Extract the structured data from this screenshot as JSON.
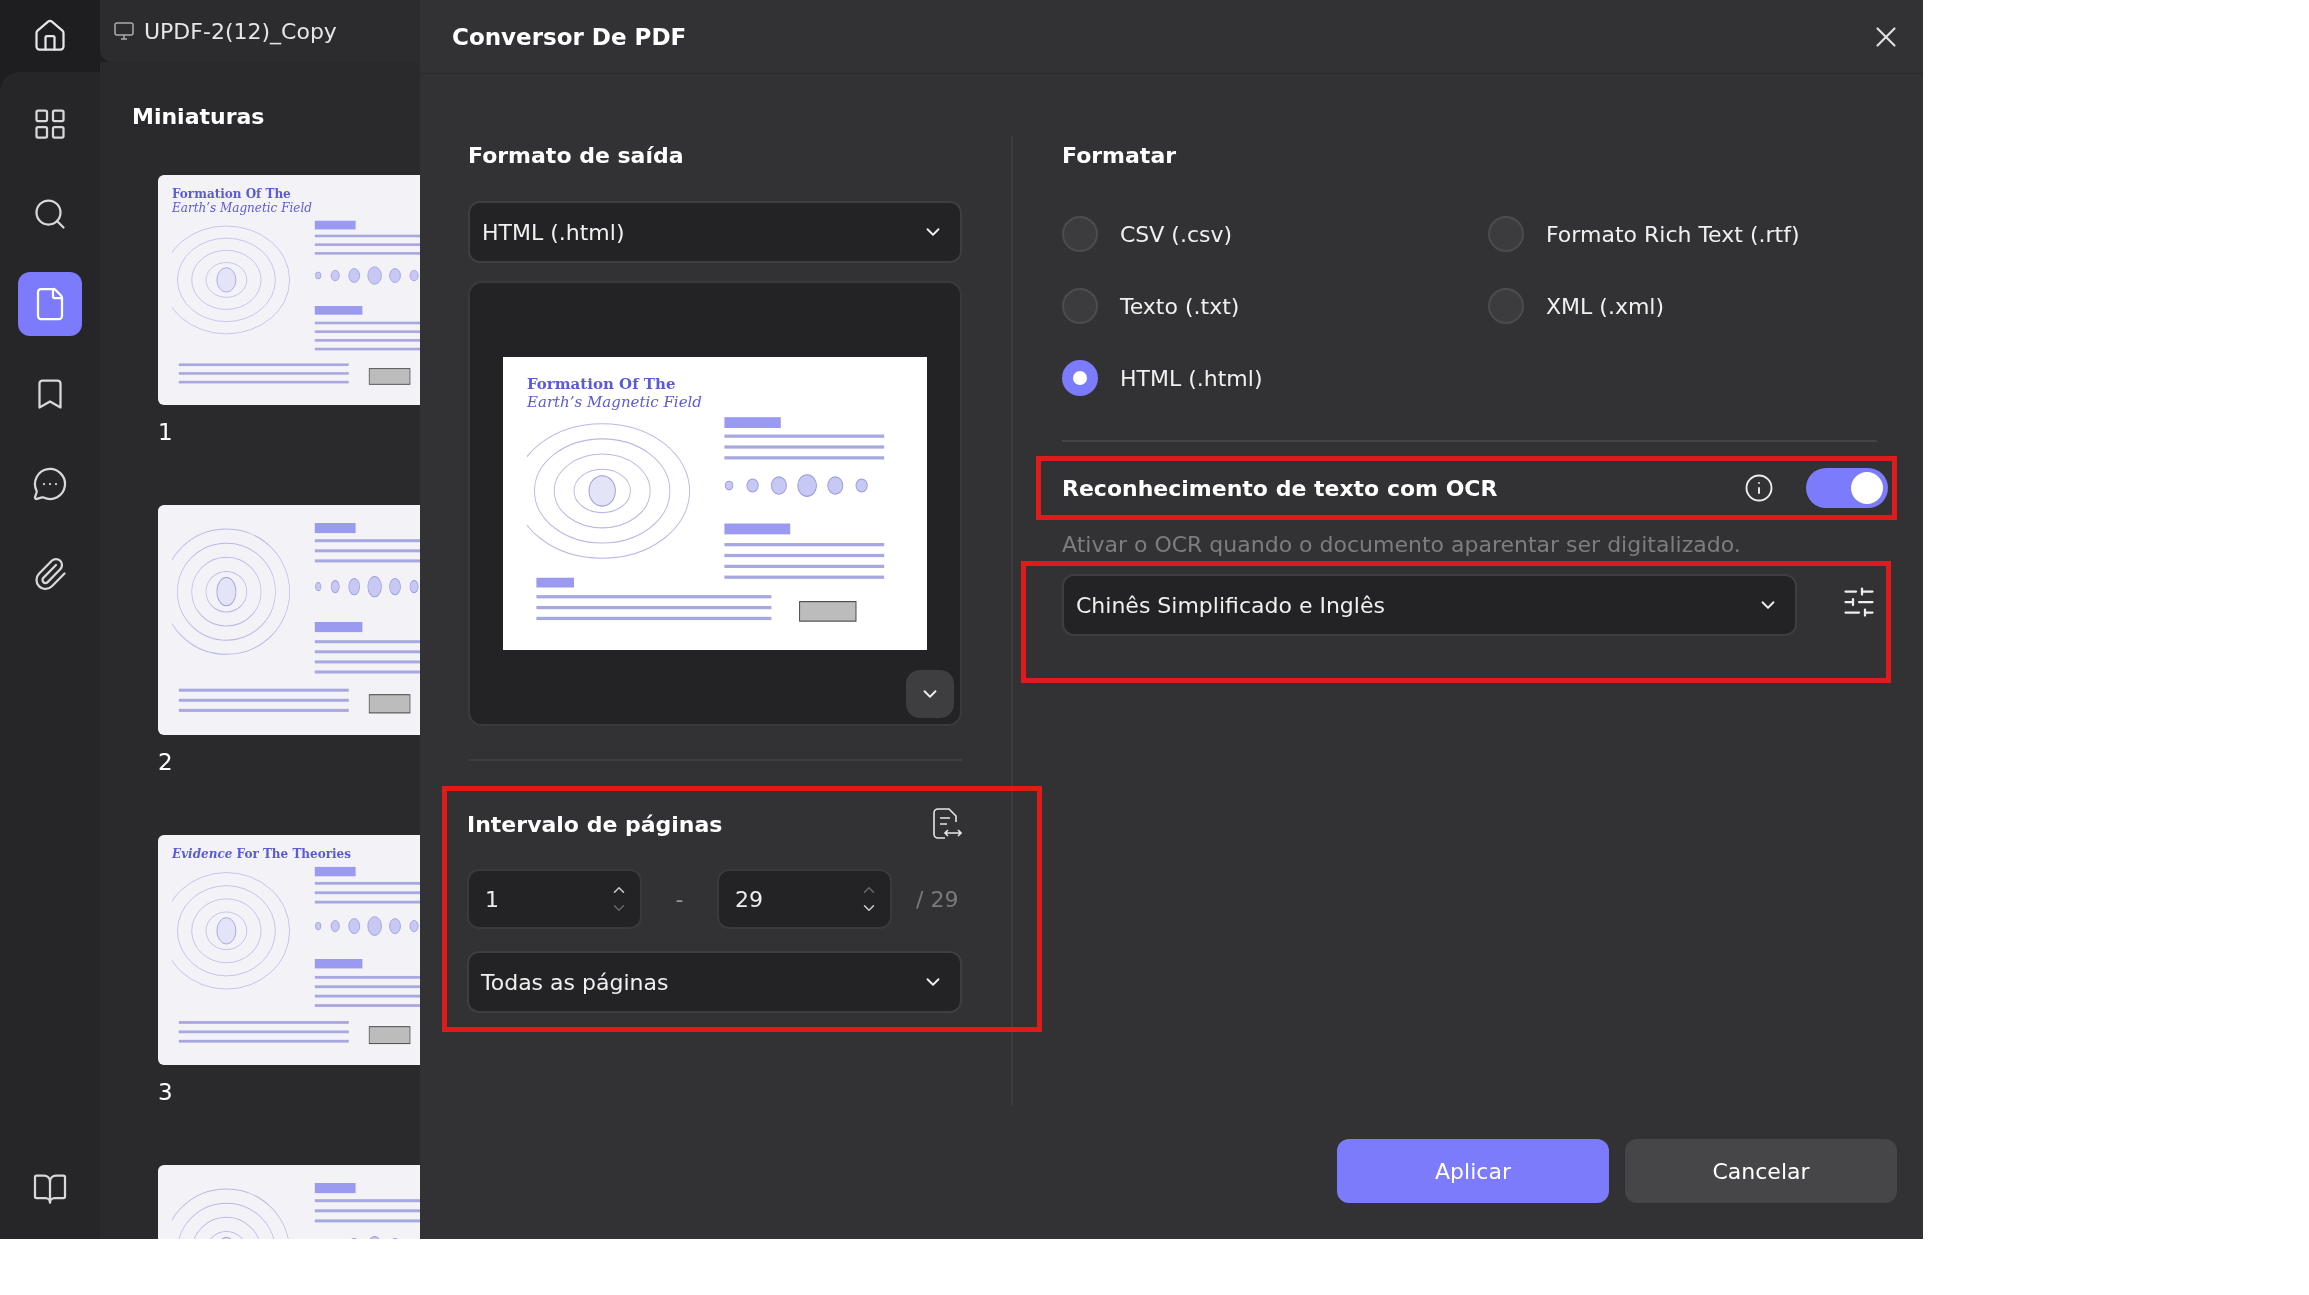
{
  "top_bar": {
    "tab_title": "UPDF-2(12)_Copy"
  },
  "sidebar": [
    {
      "kind": "apps",
      "selected": false
    },
    {
      "kind": "search",
      "selected": false
    },
    {
      "kind": "pages",
      "selected": true
    },
    {
      "kind": "bookmark",
      "selected": false
    },
    {
      "kind": "comment",
      "selected": false
    },
    {
      "kind": "attachment",
      "selected": false
    },
    {
      "kind": "layers",
      "selected": false
    }
  ],
  "thumbnails": {
    "title": "Miniaturas",
    "pages": [
      {
        "kind": "page",
        "number": "1",
        "title": "Formation Of The",
        "subtitle": "Earth’s Magnetic Field"
      },
      {
        "kind": "page",
        "number": "2"
      },
      {
        "kind": "page",
        "number": "3",
        "title": "*Evidence* For The Theories"
      },
      {
        "kind": "page"
      }
    ]
  },
  "dialog": {
    "title": "Conversor De PDF",
    "output_format": {
      "heading": "Formato de saída",
      "value": "HTML (.html)",
      "preview": {
        "title": "Formation Of The",
        "subtitle": "Earth’s Magnetic Field"
      }
    },
    "page_range": {
      "highlighted": true,
      "heading": "Intervalo de páginas",
      "from": "1",
      "dash": "-",
      "to": "29",
      "total": "/ 29",
      "mode": "Todas as páginas"
    },
    "format": {
      "heading": "Formatar",
      "options": [
        {
          "label": "CSV (.csv)",
          "selected": false
        },
        {
          "label": "Formato Rich Text (.rtf)",
          "selected": false
        },
        {
          "label": "Texto (.txt)",
          "selected": false
        },
        {
          "label": "XML (.xml)",
          "selected": false
        },
        {
          "label": "HTML (.html)",
          "selected": true
        }
      ]
    },
    "ocr": {
      "highlighted": true,
      "label": "Reconhecimento de texto com OCR",
      "on": true,
      "hint": "Ativar o OCR quando o documento aparentar ser digitalizado.",
      "language_highlighted": true,
      "language": "Chinês Simplificado e Inglês"
    },
    "buttons": [
      {
        "label": "Aplicar",
        "kind": "primary"
      },
      {
        "label": "Cancelar",
        "kind": "secondary"
      }
    ]
  }
}
